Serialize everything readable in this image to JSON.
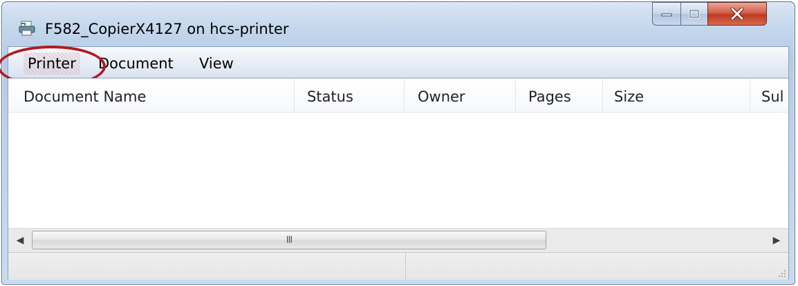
{
  "window": {
    "title": "F582_CopierX4127 on hcs-printer",
    "icons": {
      "app": "printer-icon",
      "minimize": "minimize-icon",
      "maximize": "maximize-icon",
      "close": "close-icon"
    }
  },
  "menu": {
    "items": [
      {
        "label": "Printer",
        "highlighted": true
      },
      {
        "label": "Document"
      },
      {
        "label": "View"
      }
    ],
    "highlight_color": "#b11a22"
  },
  "columns": [
    "Document Name",
    "Status",
    "Owner",
    "Pages",
    "Size",
    "Sul"
  ],
  "rows": [],
  "scrollbar": {
    "left_icon": "scroll-left-icon",
    "right_icon": "scroll-right-icon",
    "grip": "III"
  },
  "status": {
    "pane1": "",
    "pane2": ""
  }
}
